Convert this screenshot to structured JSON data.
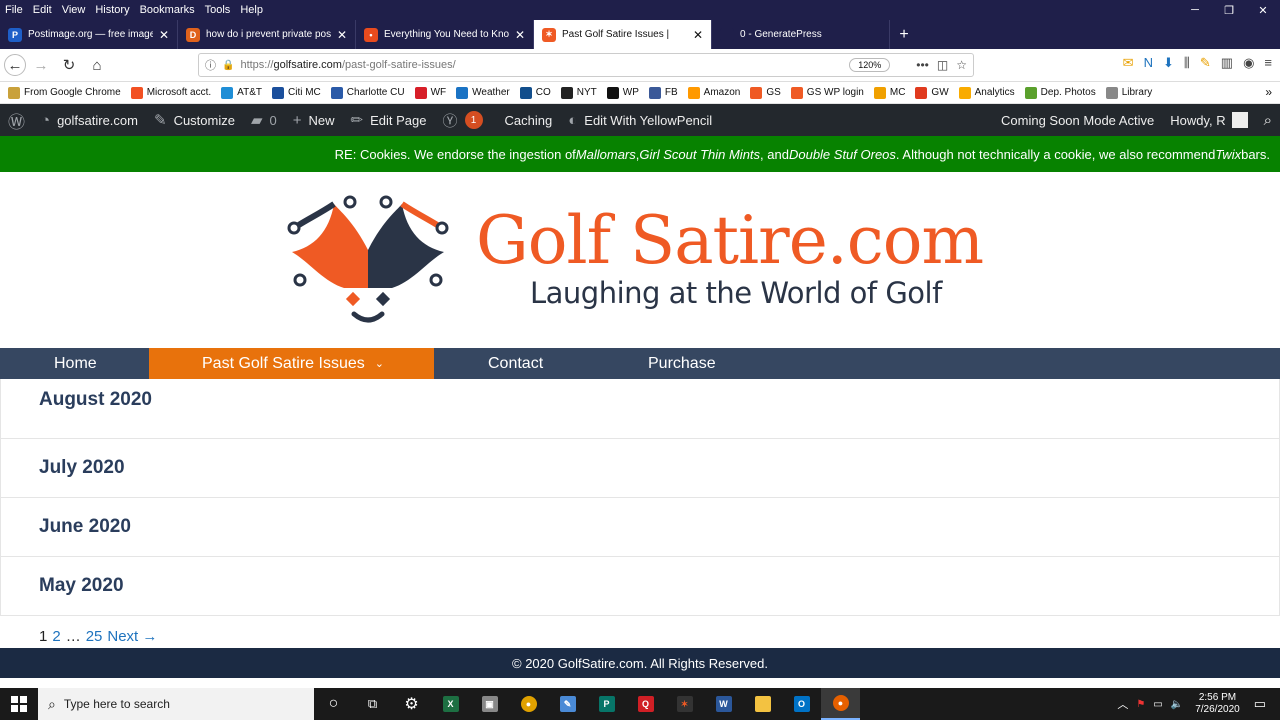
{
  "menu": [
    "File",
    "Edit",
    "View",
    "History",
    "Bookmarks",
    "Tools",
    "Help"
  ],
  "tabs": [
    {
      "title": "Postimage.org — free image h",
      "color": "#1e5fc8",
      "glyph": "P"
    },
    {
      "title": "how do i prevent private posts",
      "color": "#e0621c",
      "glyph": "D"
    },
    {
      "title": "Everything You Need to Know",
      "color": "#e94b1e",
      "glyph": "•"
    },
    {
      "title": "Past Golf Satire Issues |",
      "color": "#ef5a24",
      "glyph": "✶",
      "active": true
    },
    {
      "title": "0 - GeneratePress",
      "color": "#1f1f4a",
      "glyph": ""
    }
  ],
  "url": {
    "prefix": "https://",
    "host": "golfsatire.com",
    "path": "/past-golf-satire-issues/",
    "zoom": "120%"
  },
  "bookmarks": [
    {
      "label": "From Google Chrome",
      "color": "#c9a13b"
    },
    {
      "label": "Microsoft acct.",
      "color": "#f25022"
    },
    {
      "label": "AT&T",
      "color": "#1f8ed6"
    },
    {
      "label": "Citi MC",
      "color": "#1b4f9c"
    },
    {
      "label": "Charlotte CU",
      "color": "#2a5aa8"
    },
    {
      "label": "WF",
      "color": "#d71e28"
    },
    {
      "label": "Weather",
      "color": "#1a73c4"
    },
    {
      "label": "CO",
      "color": "#124e8c"
    },
    {
      "label": "NYT",
      "color": "#222222"
    },
    {
      "label": "WP",
      "color": "#111111"
    },
    {
      "label": "FB",
      "color": "#3b5998"
    },
    {
      "label": "Amazon",
      "color": "#ff9900"
    },
    {
      "label": "GS",
      "color": "#ef5a24"
    },
    {
      "label": "GS WP login",
      "color": "#ef5a24"
    },
    {
      "label": "MC",
      "color": "#f0a000"
    },
    {
      "label": "GW",
      "color": "#e03a1e"
    },
    {
      "label": "Analytics",
      "color": "#f9ab00"
    },
    {
      "label": "Dep. Photos",
      "color": "#5aa02c"
    },
    {
      "label": "Library",
      "color": "#888888"
    }
  ],
  "wpbar": {
    "site": "golfsatire.com",
    "customize": "Customize",
    "comments": "0",
    "new": "New",
    "edit": "Edit Page",
    "yoast_count": "1",
    "caching": "Caching",
    "yellowpencil": "Edit With YellowPencil",
    "coming_soon": "Coming Soon Mode Active",
    "howdy": "Howdy, R"
  },
  "notice": {
    "pre": "RE: Cookies. We endorse the ingestion of ",
    "c1": "Mallomars",
    "sep1": ", ",
    "c2": "Girl Scout Thin Mints",
    "sep2": ", and ",
    "c3": "Double Stuf Oreos",
    "mid": ". Although not technically a cookie, we also recommend ",
    "c4": "Twix",
    "post": " bars."
  },
  "logo": {
    "title": "Golf Satire.com",
    "tagline": "Laughing at the World of Golf"
  },
  "nav": [
    {
      "label": "Home"
    },
    {
      "label": "Past Golf Satire Issues",
      "active": true
    },
    {
      "label": "Contact"
    },
    {
      "label": "Purchase"
    }
  ],
  "archive": [
    "August 2020",
    "July 2020",
    "June 2020",
    "May 2020"
  ],
  "pager": {
    "current": "1",
    "p2": "2",
    "dots": "…",
    "last": "25",
    "next": "Next →"
  },
  "footer": "© 2020 GolfSatire.com. All Rights Reserved.",
  "taskbar": {
    "search": "Type here to search",
    "time": "2:56 PM",
    "date": "7/26/2020"
  }
}
